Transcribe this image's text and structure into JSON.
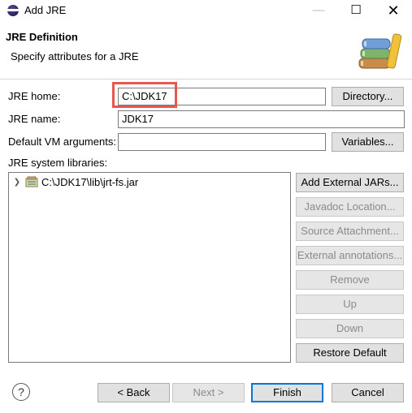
{
  "window": {
    "title": "Add JRE",
    "minimize_glyph": "—",
    "maximize_glyph": "☐",
    "close_glyph": "✕"
  },
  "header": {
    "title": "JRE Definition",
    "description": "Specify attributes for a JRE",
    "icon": "books-icon"
  },
  "form": {
    "jre_home_label": "JRE home:",
    "jre_home_value": "C:\\JDK17",
    "jre_name_label": "JRE name:",
    "jre_name_value": "JDK17",
    "vm_args_label": "Default VM arguments:",
    "vm_args_value": "",
    "directory_button": "Directory...",
    "variables_button": "Variables...",
    "libraries_label": "JRE system libraries:"
  },
  "libraries": [
    {
      "label": "C:\\JDK17\\lib\\jrt-fs.jar",
      "icon": "jar-icon"
    }
  ],
  "library_buttons": {
    "add_external_jars": "Add External JARs...",
    "javadoc_location": "Javadoc Location...",
    "source_attachment": "Source Attachment...",
    "external_annotations": "External annotations...",
    "remove": "Remove",
    "up": "Up",
    "down": "Down",
    "restore_default": "Restore Default"
  },
  "footer": {
    "help_glyph": "?",
    "back_button": "< Back",
    "next_button": "Next >",
    "finish_button": "Finish",
    "cancel_button": "Cancel"
  },
  "colors": {
    "highlight_box": "#e8574f",
    "default_button_border": "#0078d7",
    "disabled_text": "#8a8a8a"
  }
}
